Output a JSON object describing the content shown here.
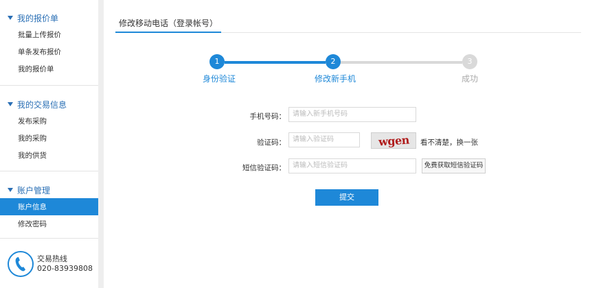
{
  "sidebar": {
    "sections": [
      {
        "title": "我的报价单",
        "items": [
          "批量上传报价",
          "单条发布报价",
          "我的报价单"
        ]
      },
      {
        "title": "我的交易信息",
        "items": [
          "发布采购",
          "我的采购",
          "我的供货"
        ]
      },
      {
        "title": "账户管理",
        "items": [
          "账户信息",
          "修改密码"
        ]
      }
    ],
    "hotline": {
      "label": "交易热线",
      "number": "020-83939808"
    }
  },
  "tab": {
    "label": "修改移动电话（登录帐号）"
  },
  "steps": [
    {
      "number": "1",
      "label": "身份验证",
      "state": "done"
    },
    {
      "number": "2",
      "label": "修改新手机",
      "state": "current"
    },
    {
      "number": "3",
      "label": "成功",
      "state": "todo"
    }
  ],
  "form": {
    "phone": {
      "label": "手机号码：",
      "placeholder": "请输入新手机号码"
    },
    "captcha": {
      "label": "验证码：",
      "placeholder": "请输入验证码",
      "image_text": "wgen",
      "refresh_text": "看不清楚，换一张"
    },
    "sms": {
      "label": "短信验证码：",
      "placeholder": "请输入短信验证码",
      "button": "免费获取短信验证码"
    },
    "submit": "提交"
  },
  "colors": {
    "accent": "#1e88d8",
    "inactive": "#d9d9d9",
    "captcha_text": "#b01c1c"
  }
}
